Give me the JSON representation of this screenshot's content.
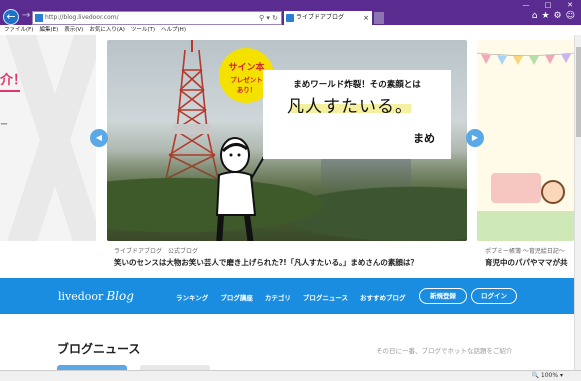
{
  "browser": {
    "url": "http://blog.livedoor.com/",
    "tab_title": "ライブドアブログ（livedoor Blo...",
    "tab_close": "×",
    "addr_controls": "⚲ ▾ ↻",
    "back": "←",
    "forward": "→",
    "window_controls": [
      "—",
      "□",
      "✕"
    ],
    "toolbar_icons": [
      "home-icon",
      "star-icon",
      "gear-icon",
      "smiley-icon"
    ],
    "menu": [
      "ファイル(F)",
      "編集(E)",
      "表示(V)",
      "お気に入り(A)",
      "ツール(T)",
      "ヘルプ(H)"
    ],
    "zoom": "🔍 100%  ▾"
  },
  "hero": {
    "badge_line1": "サイン本",
    "badge_line2": "プレゼント",
    "badge_line3": "あり！",
    "card_subtitle": "まめワールド炸裂！その素顔とは",
    "card_title": "凡人すたいる。",
    "card_signature": "まめ",
    "prev_arrow": "◀",
    "next_arrow": "▶"
  },
  "left_peek": {
    "text": "介！",
    "dash": "ー"
  },
  "captions": {
    "main_source": "ライブドアブログ　公式ブログ",
    "main_title": "笑いのセンスは大物お笑い芸人で磨き上げられた?!「凡人すたいる。」まめさんの素顔は？",
    "right_source": "ポプミー帳簿 ～育児絵日記～",
    "right_title": "育児中のパパやママが共"
  },
  "nav": {
    "logo_text": "livedoor",
    "logo_script": "Blog",
    "links": [
      "ランキング",
      "ブログ講座",
      "カテゴリ",
      "ブログニュース",
      "おすすめブログ"
    ],
    "register": "新規登録",
    "login": "ログイン"
  },
  "section": {
    "title": "ブログニュース",
    "note": "その日に一番、ブログでホットな話題をご紹介"
  }
}
